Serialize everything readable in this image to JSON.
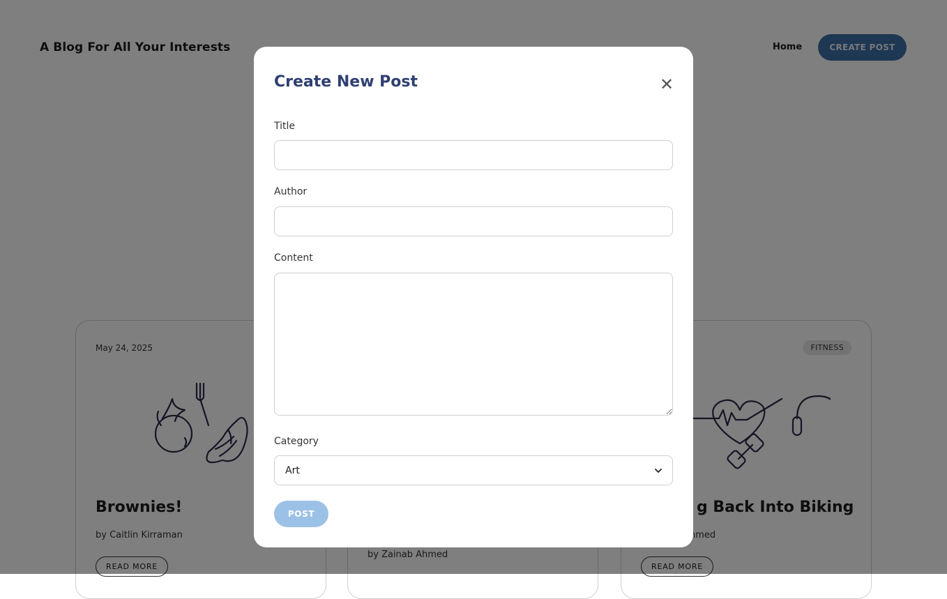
{
  "header": {
    "brand": "A Blog For All Your Interests",
    "nav_home": "Home",
    "create_post_label": "CREATE POST"
  },
  "cards": [
    {
      "date": "May 24, 2025",
      "title": "Brownies!",
      "author": "by Caitlin Kirraman",
      "read_more": "READ MORE",
      "illustration": "food-doodle"
    },
    {
      "author": "by Zainab Ahmed"
    },
    {
      "badge": "FITNESS",
      "title": "g Back Into Biking",
      "author": "hmed",
      "read_more": "READ MORE",
      "illustration": "fitness-doodle"
    }
  ],
  "modal": {
    "title": "Create New Post",
    "close_icon": "close-icon",
    "fields": {
      "title_label": "Title",
      "title_value": "",
      "author_label": "Author",
      "author_value": "",
      "content_label": "Content",
      "content_value": "",
      "category_label": "Category",
      "category_selected": "Art"
    },
    "post_label": "POST"
  },
  "colors": {
    "overlay": "rgba(0,0,0,0.5)",
    "modal_title": "#2f3f72",
    "post_button": "#9cc1e6",
    "create_button": "#3d6fa6"
  }
}
